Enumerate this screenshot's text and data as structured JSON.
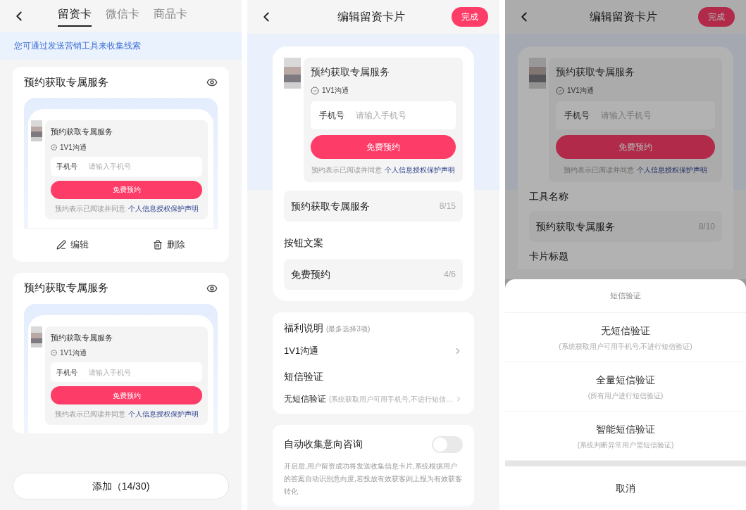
{
  "card_list_screen": {
    "tabs": [
      {
        "label": "留资卡",
        "selected": true
      },
      {
        "label": "微信卡",
        "selected": false
      },
      {
        "label": "商品卡",
        "selected": false
      }
    ],
    "notice": "您可通过发送营销工具来收集线索",
    "cards": [
      {
        "title": "预约获取专属服务",
        "preview": {
          "title": "预约获取专属服务",
          "benefit": "1V1沟通",
          "phone_label": "手机号",
          "phone_placeholder": "请输入手机号",
          "button": "免费预约",
          "consent": "预约表示已阅读并同意",
          "consent_link": "个人信息授权保护声明"
        },
        "actions": [
          {
            "kind": "edit",
            "label": "编辑"
          },
          {
            "kind": "delete",
            "label": "删除"
          }
        ]
      },
      {
        "title": "预约获取专属服务",
        "preview": {
          "title": "预约获取专属服务",
          "benefit": "1V1沟通",
          "phone_label": "手机号",
          "phone_placeholder": "请输入手机号",
          "button": "免费预约",
          "consent": "预约表示已阅读并同意",
          "consent_link": "个人信息授权保护声明"
        }
      }
    ],
    "add_button": "添加（14/30)"
  },
  "edit_screen": {
    "title": "编辑留资卡片",
    "done_button": "完成",
    "preview": {
      "title": "预约获取专属服务",
      "benefit": "1V1沟通",
      "phone_label": "手机号",
      "phone_placeholder": "请输入手机号",
      "button": "免费预约",
      "consent": "预约表示已阅读并同意",
      "consent_link": "个人信息授权保护声明"
    },
    "name_field": {
      "value": "预约获取专属服务",
      "counter": "8/15"
    },
    "button_text_heading": "按钮文案",
    "button_text_field": {
      "value": "免费预约",
      "counter": "4/6"
    },
    "benefits": {
      "heading": "福利说明",
      "hint": "(最多选择3项)",
      "value": "1V1沟通"
    },
    "sms": {
      "heading": "短信验证",
      "value": "无短信验证",
      "hint": "(系统获取用户可用手机号,不进行短信…"
    },
    "auto_collect": {
      "label": "自动收集意向咨询",
      "on": false,
      "description": "开启后,用户留资成功将发送收集信息卡片,系统根据用户的答案自动识别意向度,若投放有效获客则上报为有效获客转化"
    }
  },
  "sms_sheet_screen": {
    "title": "编辑留资卡片",
    "done_button": "完成",
    "preview": {
      "title": "预约获取专属服务",
      "benefit": "1V1沟通",
      "phone_label": "手机号",
      "phone_placeholder": "请输入手机号",
      "button": "免费预约",
      "consent": "预约表示已阅读并同意",
      "consent_link": "个人信息授权保护声明"
    },
    "tool_name_heading": "工具名称",
    "tool_name_field": {
      "value": "预约获取专属服务",
      "counter": "8/10"
    },
    "card_title_heading": "卡片标题",
    "sheet": {
      "title": "短信验证",
      "options": [
        {
          "label": "无短信验证",
          "hint": "(系统获取用户可用手机号,不进行短信验证)"
        },
        {
          "label": "全量短信验证",
          "hint": "(所有用户进行短信验证)"
        },
        {
          "label": "智能短信验证",
          "hint": "(系统判断异常用户需短信验证)"
        }
      ],
      "cancel": "取消"
    }
  }
}
